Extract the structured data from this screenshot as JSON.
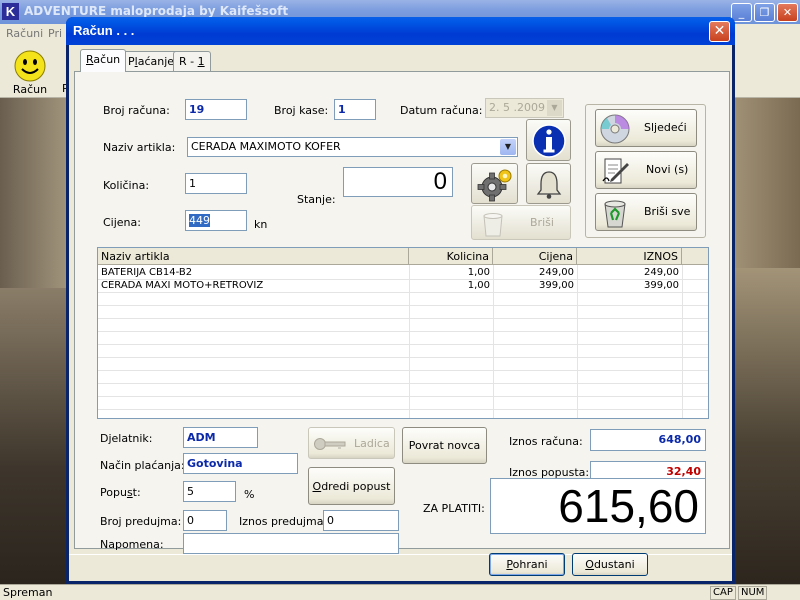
{
  "app": {
    "logo_letter": "K",
    "title": "ADVENTURE maloprodaja by Kaifešsoft",
    "window_buttons": [
      "_",
      "❐",
      "✕"
    ],
    "menu": [
      "Računi",
      "Pri"
    ],
    "toolbar": [
      {
        "label": "Računi",
        "short_label": "Račun",
        "icon": "smiley-icon"
      },
      {
        "label": "P"
      }
    ],
    "status_text": "Spreman",
    "status_panels": [
      "CAP",
      "NUM"
    ]
  },
  "dialog": {
    "title": "Račun . . .",
    "close_glyph": "✕",
    "tabs": [
      {
        "label": "Račun",
        "underline": "R",
        "rest": "ačun",
        "active": true
      },
      {
        "label": "Plaćanje",
        "pre": "P",
        "underline": "l",
        "rest": "aćanje",
        "active": false
      },
      {
        "label": "R - 1",
        "pre": "R - ",
        "underline": "1",
        "rest": "",
        "active": false
      }
    ],
    "form": {
      "broj_racuna_label": "Broj računa:",
      "broj_racuna_value": "19",
      "broj_kase_label": "Broj kase:",
      "broj_kase_value": "1",
      "datum_label": "Datum računa:",
      "datum_value": "2. 5 .2009",
      "naziv_label": "Naziv artikla:",
      "naziv_value": "CERADA MAXIMOTO KOFER",
      "kolicina_label": "Količina:",
      "kolicina_value": "1",
      "cijena_label": "Cijena:",
      "cijena_value": "449",
      "cijena_unit": "kn",
      "stanje_label": "Stanje:",
      "stanje_value": "0",
      "brisi_label": "Briši"
    },
    "nav_buttons": {
      "sljedeci": "Sljedeći",
      "novi": "Novi (s)",
      "brisi_sve": "Briši sve"
    },
    "grid": {
      "columns": [
        "Naziv artikla",
        "Kolicina",
        "Cijena",
        "IZNOS"
      ],
      "rows": [
        [
          "BATERIJA CB14-B2",
          "1,00",
          "249,00",
          "249,00"
        ],
        [
          "CERADA MAXI MOTO+RETROVIZ",
          "1,00",
          "399,00",
          "399,00"
        ]
      ]
    },
    "bottom": {
      "djelatnik_label": "Djelatnik:",
      "djelatnik_value": "ADM",
      "nacin_label": "Način plaćanja:",
      "nacin_value": "Gotovina",
      "popust_label": "Popust:",
      "popust_value": "5",
      "popust_unit": "%",
      "broj_predujma_label": "Broj predujma:",
      "broj_predujma_value": "0",
      "iznos_predujma_label": "Iznos predujma:",
      "iznos_predujma_value": "0",
      "napomena_label": "Napomena:",
      "napomena_value": "",
      "ladica_label": "Ladica",
      "povrat_label": "Povrat novca",
      "odredi_label": "Odredi popust",
      "iznos_racuna_label": "Iznos računa:",
      "iznos_racuna_value": "648,00",
      "iznos_racuna_color": "#0b29a8",
      "iznos_popusta_label": "Iznos popusta:",
      "iznos_popusta_value": "32,40",
      "iznos_popusta_color": "#c00000",
      "za_platiti_label": "ZA PLATITI:",
      "za_platiti_value": "615,60"
    },
    "footer": {
      "pohrani": "Pohrani",
      "odustani": "Odustani"
    }
  }
}
